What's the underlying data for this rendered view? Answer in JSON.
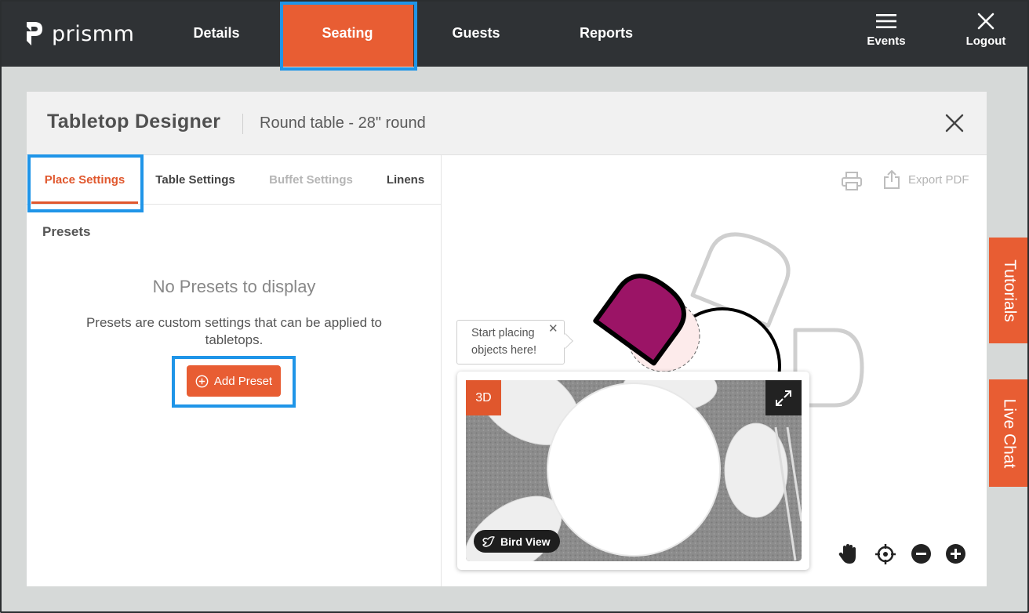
{
  "brand": {
    "name": "prismm"
  },
  "nav": {
    "items": [
      {
        "label": "Details"
      },
      {
        "label": "Seating"
      },
      {
        "label": "Guests"
      },
      {
        "label": "Reports"
      }
    ],
    "events_label": "Events",
    "logout_label": "Logout"
  },
  "dialog": {
    "title": "Tabletop Designer",
    "subtitle": "Round table - 28\" round",
    "tabs": [
      {
        "label": "Place Settings",
        "state": "active"
      },
      {
        "label": "Table Settings",
        "state": "normal"
      },
      {
        "label": "Buffet Settings",
        "state": "disabled"
      },
      {
        "label": "Linens",
        "state": "normal"
      }
    ],
    "presets": {
      "heading": "Presets",
      "empty_title": "No Presets to display",
      "empty_description": "Presets are custom settings that can be applied to tabletops.",
      "add_button_label": "Add Preset"
    }
  },
  "canvas": {
    "export_label": "Export PDF",
    "tooltip_text": "Start placing objects here!",
    "preview": {
      "badge_label": "3D",
      "bird_view_label": "Bird View"
    }
  },
  "side_tabs": {
    "tutorials_label": "Tutorials",
    "live_chat_label": "Live Chat"
  },
  "colors": {
    "topbar": "#2f3235",
    "accent": "#e85d33",
    "highlight": "#1f95e8",
    "chair_selected": "#9b1466"
  }
}
